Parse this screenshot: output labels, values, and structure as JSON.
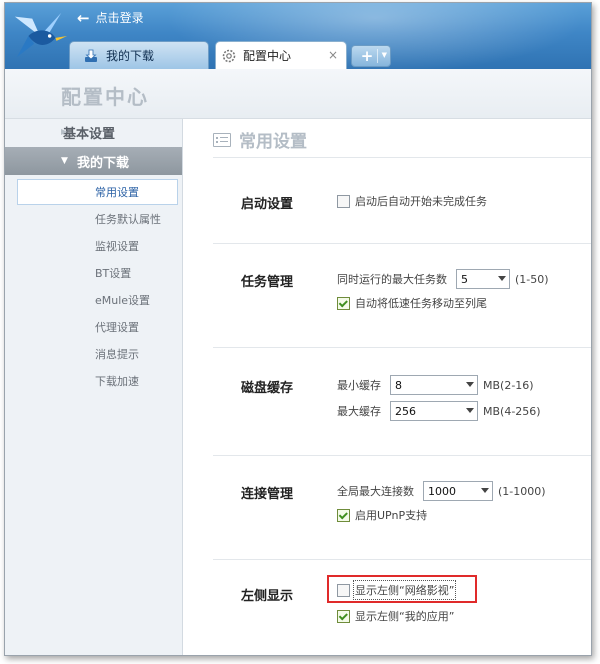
{
  "titlebar": {
    "login_label": "点击登录",
    "back_icon": "back-arrow-icon",
    "logo_icon": "hummingbird-logo-icon",
    "colors": {
      "bar": "#3f86c6",
      "highlight": "#e02a2a"
    }
  },
  "tabs": [
    {
      "label": "我的下载",
      "icon": "download-icon"
    },
    {
      "label": "配置中心",
      "icon": "gear-icon",
      "close": "×"
    }
  ],
  "tab_add": {
    "label": "+",
    "icon": "add-icon"
  },
  "page": {
    "title": "配置中心"
  },
  "sidebar": {
    "basic": "基本设置",
    "my_downloads": "我的下载",
    "items": [
      {
        "label": "常用设置",
        "active": true
      },
      {
        "label": "任务默认属性"
      },
      {
        "label": "监视设置"
      },
      {
        "label": "BT设置"
      },
      {
        "label": "eMule设置"
      },
      {
        "label": "代理设置"
      },
      {
        "label": "消息提示"
      },
      {
        "label": "下载加速"
      }
    ]
  },
  "main": {
    "title": "常用设置",
    "startup": {
      "label": "启动设置",
      "auto_start": {
        "text": "启动后自动开始未完成任务",
        "checked": false
      }
    },
    "task": {
      "label": "任务管理",
      "max_tasks_label": "同时运行的最大任务数",
      "max_tasks_value": "5",
      "max_tasks_range": "(1-50)",
      "move_slow": {
        "text": "自动将低速任务移动至列尾",
        "checked": true
      }
    },
    "cache": {
      "label": "磁盘缓存",
      "min_label": "最小缓存",
      "min_value": "8",
      "min_range": "MB(2-16)",
      "max_label": "最大缓存",
      "max_value": "256",
      "max_range": "MB(4-256)"
    },
    "connection": {
      "label": "连接管理",
      "max_conn_label": "全局最大连接数",
      "max_conn_value": "1000",
      "max_conn_range": "(1-1000)",
      "upnp": {
        "text": "启用UPnP支持",
        "checked": true
      }
    },
    "left_display": {
      "label": "左侧显示",
      "show_web_video": {
        "text": "显示左侧“网络影视”",
        "checked": false
      },
      "show_my_apps": {
        "text": "显示左侧“我的应用”",
        "checked": true
      }
    }
  }
}
